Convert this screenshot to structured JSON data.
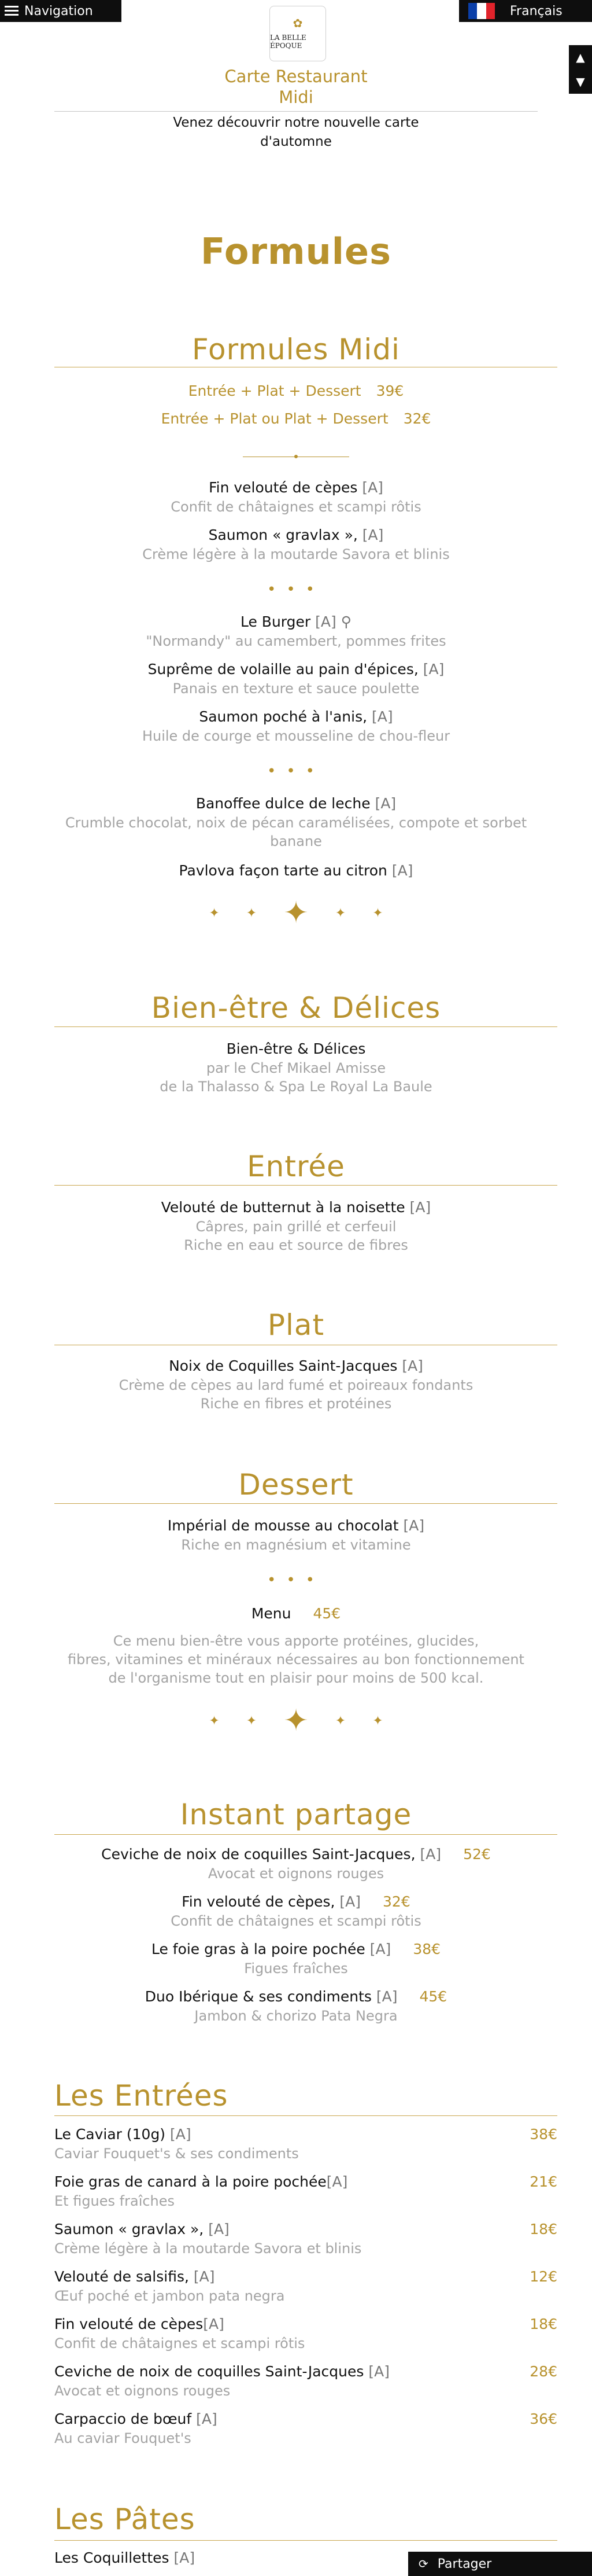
{
  "topbar": {
    "nav_label": "Navigation",
    "lang_label": "Français"
  },
  "flag_colors": [
    "#0b3fa8",
    "#ffffff",
    "#e1232b"
  ],
  "header": {
    "logo_text": "LA BELLE ÉPOQUE",
    "title_line1": "Carte Restaurant",
    "title_line2": "Midi",
    "intro_line1": "Venez découvrir notre nouvelle carte",
    "intro_line2": "d'automne"
  },
  "formules": {
    "title": "Formules",
    "midi_title": "Formules Midi",
    "options": [
      {
        "label": "Entrée + Plat + Dessert",
        "price": "39€"
      },
      {
        "label": "Entrée + Plat ou Plat + Dessert",
        "price": "32€"
      }
    ],
    "entrees": [
      {
        "name": "Fin velouté de cèpes",
        "tag": "[A]",
        "desc": "Confit de châtaignes et scampi rôtis"
      },
      {
        "name": "Saumon « gravlax »,",
        "tag": "[A]",
        "desc": "Crème légère à la moutarde Savora et blinis"
      }
    ],
    "plats": [
      {
        "name": "Le Burger",
        "tag": "[A]",
        "desc": "\"Normandy\" au camembert, pommes frites"
      },
      {
        "name": "Suprême de volaille au pain d'épices,",
        "tag": "[A]",
        "desc": "Panais en texture et sauce poulette"
      },
      {
        "name": "Saumon poché à l'anis,",
        "tag": "[A]",
        "desc": "Huile de courge et mousseline de chou-fleur"
      }
    ],
    "desserts": [
      {
        "name": "Banoffee dulce de leche",
        "tag": "[A]",
        "desc1": "Crumble chocolat, noix de pécan caramélisées, compote et sorbet",
        "desc2": "banane"
      },
      {
        "name": "Pavlova façon tarte au citron",
        "tag": "[A]"
      }
    ]
  },
  "bienetre": {
    "title": "Bien-être & Délices",
    "sub_title": "Bien-être & Délices",
    "chef": "par le Chef Mikael Amisse",
    "place": "de la Thalasso & Spa Le Royal La Baule",
    "entree_title": "Entrée",
    "entree": {
      "name": "Velouté de butternut à la noisette",
      "tag": "[A]",
      "desc1": "Câpres, pain grillé et cerfeuil",
      "desc2": "Riche en eau et source de fibres"
    },
    "plat_title": "Plat",
    "plat": {
      "name": "Noix de Coquilles Saint-Jacques",
      "tag": "[A]",
      "desc1": "Crème de cèpes au lard fumé et poireaux fondants",
      "desc2": "Riche en fibres et protéines"
    },
    "dessert_title": "Dessert",
    "dessert": {
      "name": "Impérial de mousse au chocolat",
      "tag": "[A]",
      "desc1": "Riche en magnésium et vitamine"
    },
    "menu_label": "Menu",
    "menu_price": "45€",
    "menu_desc1": "Ce menu bien-être vous apporte protéines, glucides,",
    "menu_desc2": "fibres, vitamines et minéraux nécessaires au bon fonctionnement",
    "menu_desc3": "de l'organisme tout en plaisir pour moins de 500 kcal."
  },
  "partage": {
    "title": "Instant partage",
    "items": [
      {
        "name": "Ceviche de noix de coquilles Saint-Jacques,",
        "tag": "[A]",
        "price": "52€",
        "desc": "Avocat et oignons rouges"
      },
      {
        "name": "Fin velouté de cèpes,",
        "tag": "[A]",
        "price": "32€",
        "desc": "Confit de châtaignes et scampi rôtis"
      },
      {
        "name": "Le foie gras à la poire pochée",
        "tag": "[A]",
        "price": "38€",
        "desc": "Figues fraîches"
      },
      {
        "name": "Duo Ibérique & ses condiments",
        "tag": "[A]",
        "price": "45€",
        "desc": "Jambon & chorizo Pata Negra"
      }
    ]
  },
  "entrees": {
    "title": "Les Entrées",
    "items": [
      {
        "name": "Le Caviar (10g)",
        "tag": "[A]",
        "price": "38€",
        "desc": "Caviar Fouquet's & ses condiments"
      },
      {
        "name": "Foie gras de canard à la poire pochée",
        "tag": "[A]",
        "price": "21€",
        "desc": "Et figues fraîches"
      },
      {
        "name": "Saumon « gravlax »,",
        "tag": "[A]",
        "price": "18€",
        "desc": "Crème légère à la moutarde Savora et blinis"
      },
      {
        "name": "Velouté de salsifis,",
        "tag": "[A]",
        "price": "12€",
        "desc": "Œuf poché et jambon pata negra"
      },
      {
        "name": "Fin velouté de cèpes",
        "tag": "[A]",
        "price": "18€",
        "desc": "Confit de châtaignes et scampi rôtis"
      },
      {
        "name": "Ceviche de noix de coquilles Saint-Jacques",
        "tag": "[A]",
        "price": "28€",
        "desc": "Avocat et oignons rouges"
      },
      {
        "name": "Carpaccio de bœuf",
        "tag": "[A]",
        "price": "36€",
        "desc": "Au caviar Fouquet's"
      }
    ]
  },
  "pates": {
    "title": "Les Pâtes",
    "items": [
      {
        "name": "Les Coquillettes",
        "tag": "[A]"
      }
    ]
  },
  "share": {
    "label": "Partager"
  }
}
